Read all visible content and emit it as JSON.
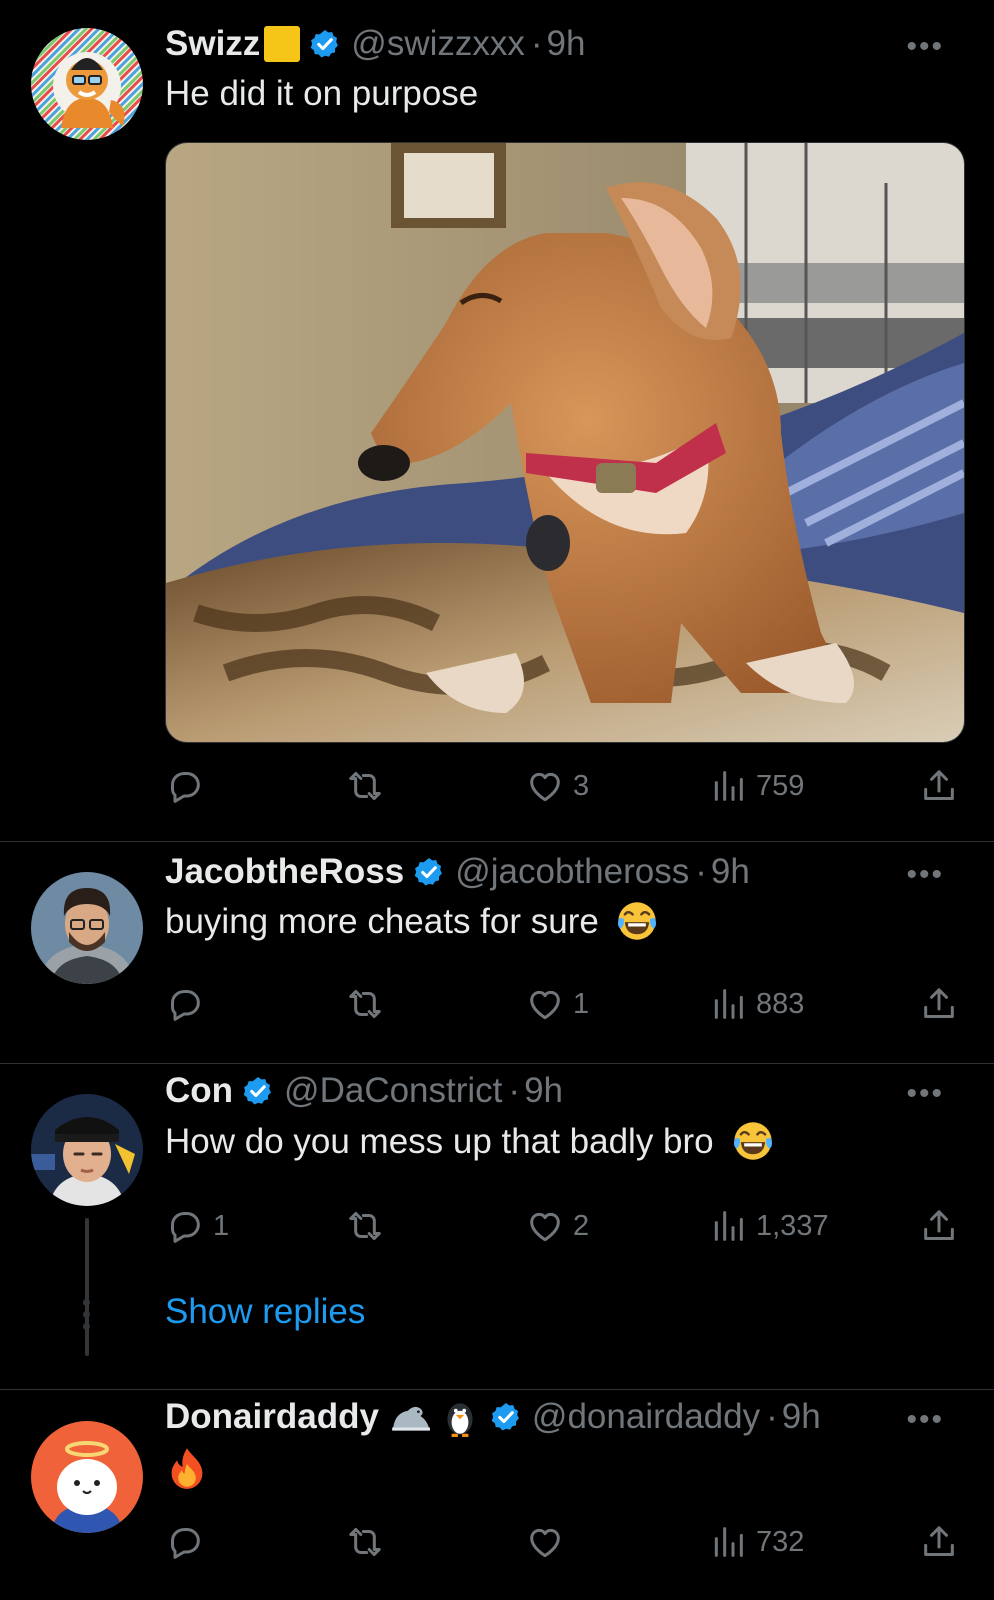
{
  "tweets": [
    {
      "name": "Swizz",
      "handle": "@swizzxxx",
      "time": "9h",
      "text": "He did it on purpose",
      "stats": {
        "replies": "",
        "reposts": "",
        "likes": "3",
        "views": "759"
      }
    },
    {
      "name": "JacobtheRoss",
      "handle": "@jacobtheross",
      "time": "9h",
      "text": "buying more cheats for sure",
      "stats": {
        "replies": "",
        "reposts": "",
        "likes": "1",
        "views": "883"
      }
    },
    {
      "name": "Con",
      "handle": "@DaConstrict",
      "time": "9h",
      "text": "How do you mess up that badly bro",
      "stats": {
        "replies": "1",
        "reposts": "",
        "likes": "2",
        "views": "1,337"
      }
    },
    {
      "name": "Donairdaddy",
      "handle": "@donairdaddy",
      "time": "9h",
      "text": "",
      "stats": {
        "replies": "",
        "reposts": "",
        "likes": "",
        "views": "732"
      }
    }
  ],
  "show_replies_label": "Show replies",
  "separator": "·",
  "more_label": "•••",
  "emoji": {
    "name_square": "yellow-square",
    "laugh": "tears-of-joy",
    "seal": "seal",
    "penguin": "penguin",
    "fire": "fire"
  },
  "colors": {
    "background": "#000000",
    "text": "#e7e9ea",
    "muted": "#71767b",
    "accent": "#1d9bf0",
    "divider": "#2f3336"
  },
  "icons": [
    "reply-icon",
    "repost-icon",
    "like-icon",
    "views-icon",
    "share-icon",
    "verified-badge-icon",
    "more-icon"
  ]
}
